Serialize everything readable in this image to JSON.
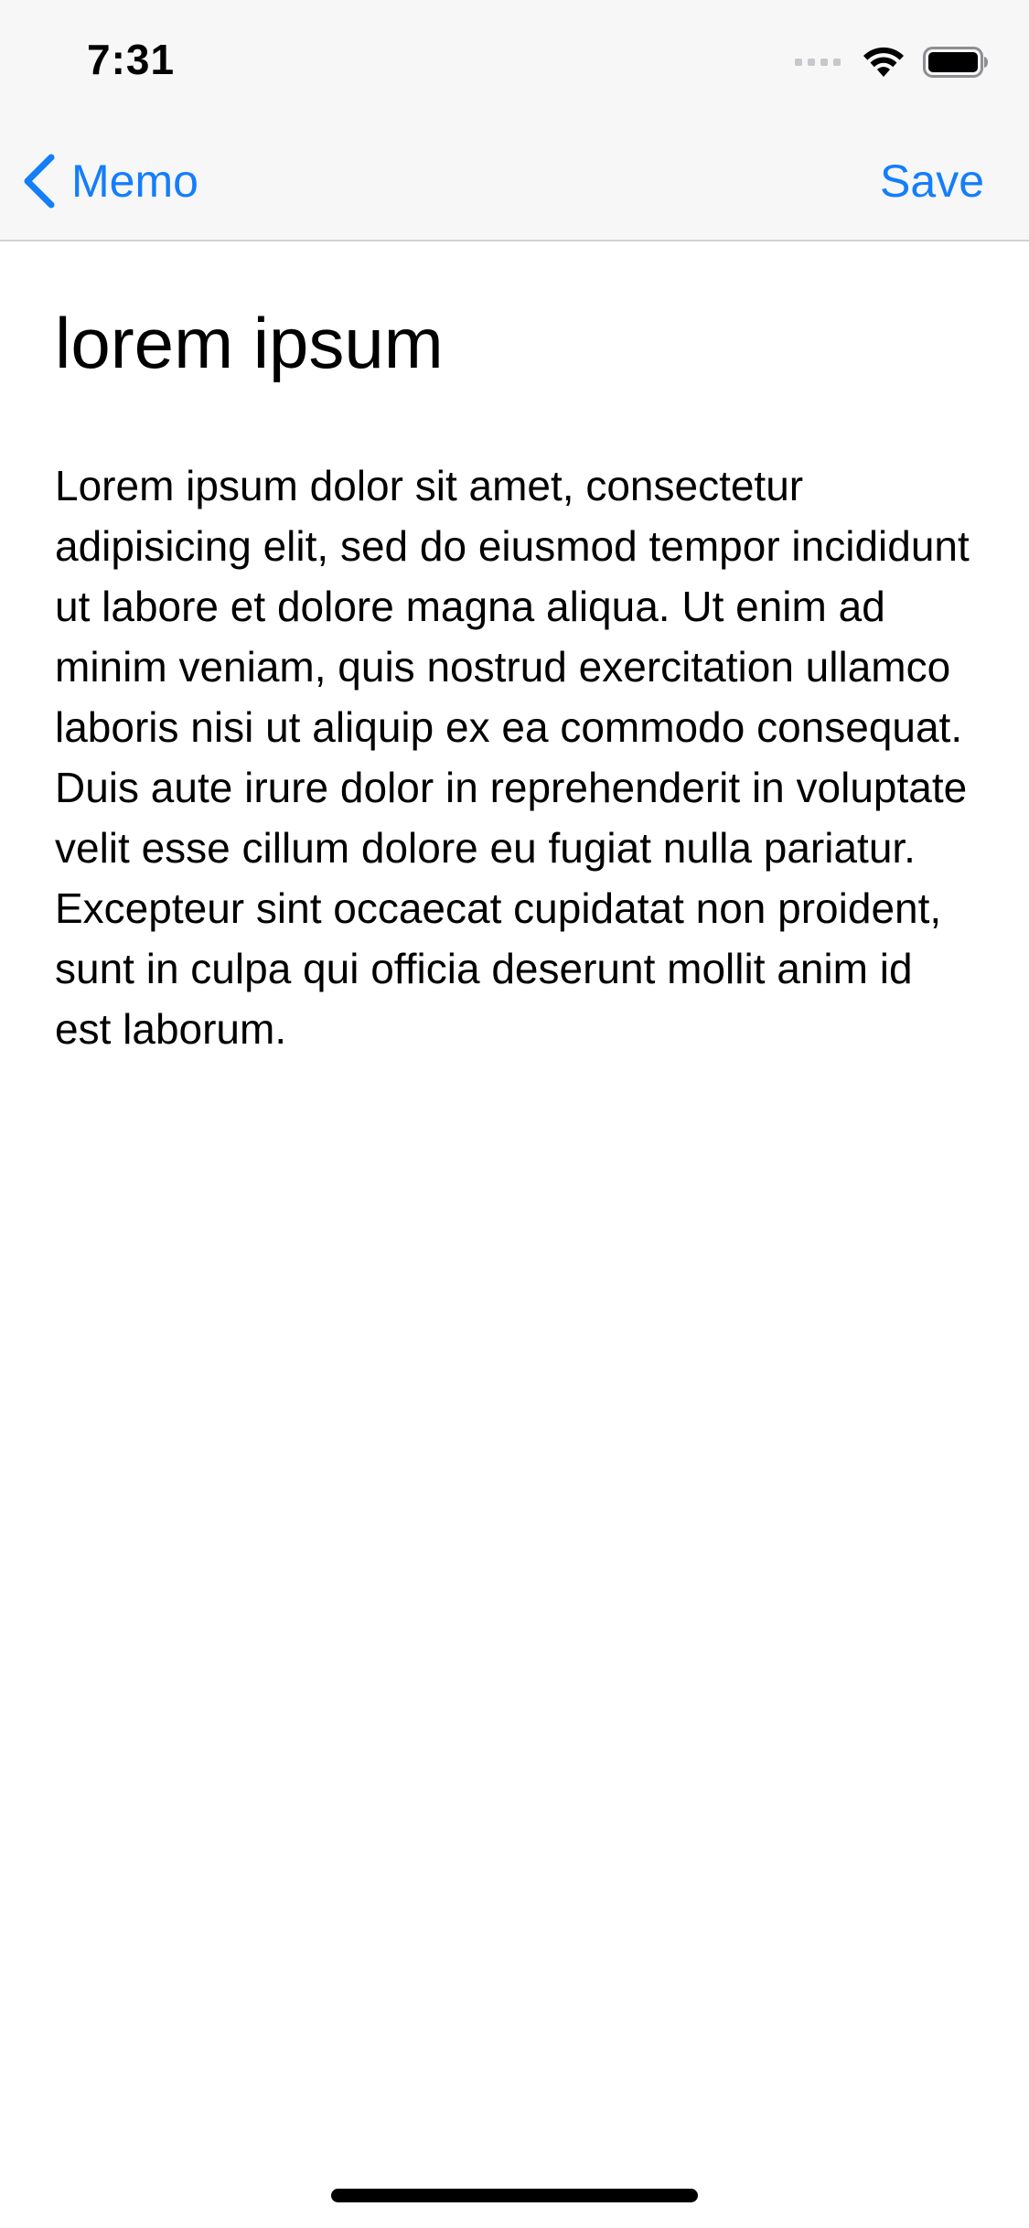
{
  "status_bar": {
    "time": "7:31"
  },
  "nav": {
    "back_label": "Memo",
    "save_label": "Save"
  },
  "memo": {
    "title": "lorem ipsum",
    "body": "Lorem ipsum dolor sit amet, consectetur adipisicing elit, sed do eiusmod tempor incididunt ut labore et dolore magna aliqua. Ut enim ad minim veniam, quis nostrud exercitation ullamco laboris nisi ut aliquip ex ea commodo consequat. Duis aute irure dolor in reprehenderit in voluptate velit esse cillum dolore eu fugiat nulla pariatur. Excepteur sint occaecat cupidatat non proident, sunt in culpa qui officia deserunt mollit anim id est laborum."
  },
  "icons": {
    "signal": "cellular-signal-icon",
    "wifi": "wifi-icon",
    "battery": "battery-icon",
    "back": "chevron-left-icon"
  },
  "colors": {
    "accent": "#147efb",
    "bar_background": "#f7f7f7",
    "text": "#000000"
  }
}
